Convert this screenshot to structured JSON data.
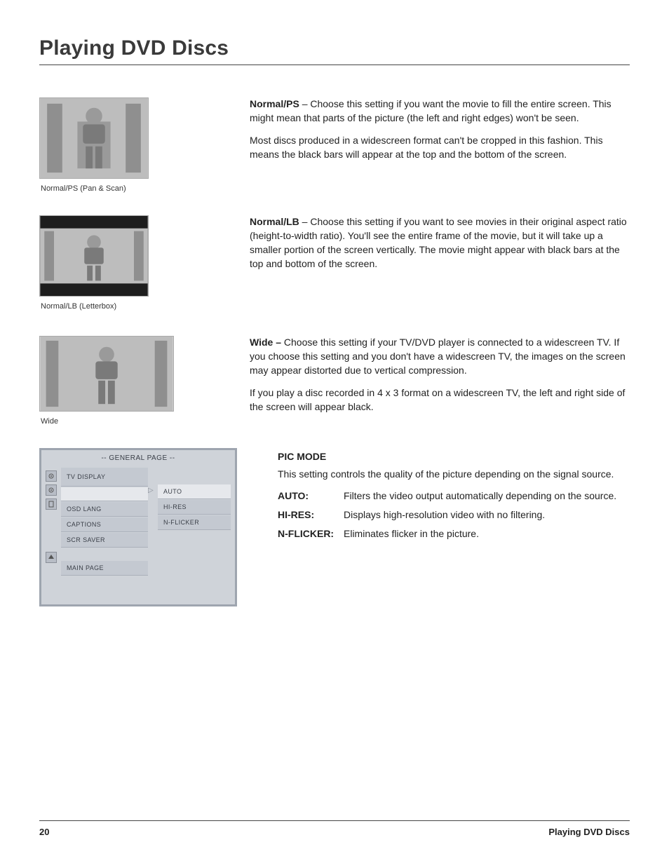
{
  "page_title": "Playing DVD Discs",
  "sections": {
    "normal_ps": {
      "caption": "Normal/PS (Pan & Scan)",
      "heading": "Normal/PS",
      "p1": " –   Choose this setting if you want the movie to fill the entire screen. This might mean that parts of the picture (the left and right edges) won't be seen.",
      "p2": "Most discs produced in a widescreen format can't be cropped in this fashion. This means the black bars will appear at the top and the bottom of the screen."
    },
    "normal_lb": {
      "caption": "Normal/LB (Letterbox)",
      "heading": "Normal/LB",
      "p1": " – Choose this setting if you want to see movies in their original aspect ratio (height-to-width ratio). You'll see the entire frame of the movie, but it will take up a smaller portion of the screen vertically. The movie might appear with black bars at the top and bottom of the screen."
    },
    "wide": {
      "caption": "Wide",
      "heading": "Wide –",
      "p1": "  Choose this setting if your TV/DVD player is connected to a widescreen TV. If you choose this setting and you don't have a widescreen TV, the images on the screen may appear distorted due to vertical compression.",
      "p2": "If you play a disc recorded in 4 x 3 format on a widescreen TV, the left and right side of the screen will appear black."
    }
  },
  "menu": {
    "header": "-- GENERAL PAGE --",
    "left": [
      "TV DISPLAY",
      "",
      "OSD LANG",
      "CAPTIONS",
      "SCR SAVER"
    ],
    "main_page": "MAIN PAGE",
    "right": [
      "AUTO",
      "HI-RES",
      "N-FLICKER"
    ]
  },
  "picmode": {
    "title": "PIC MODE",
    "intro": "This setting controls the quality of the picture depending on the signal source.",
    "auto_label": "AUTO:",
    "auto_text": "Filters the video output automatically depending on the source.",
    "hires_label": "HI-RES:",
    "hires_text": "Displays high-resolution video with no filtering.",
    "nflicker_label": "N-FLICKER:",
    "nflicker_text": "Eliminates flicker in the picture."
  },
  "footer": {
    "page_number": "20",
    "title": "Playing DVD Discs"
  }
}
